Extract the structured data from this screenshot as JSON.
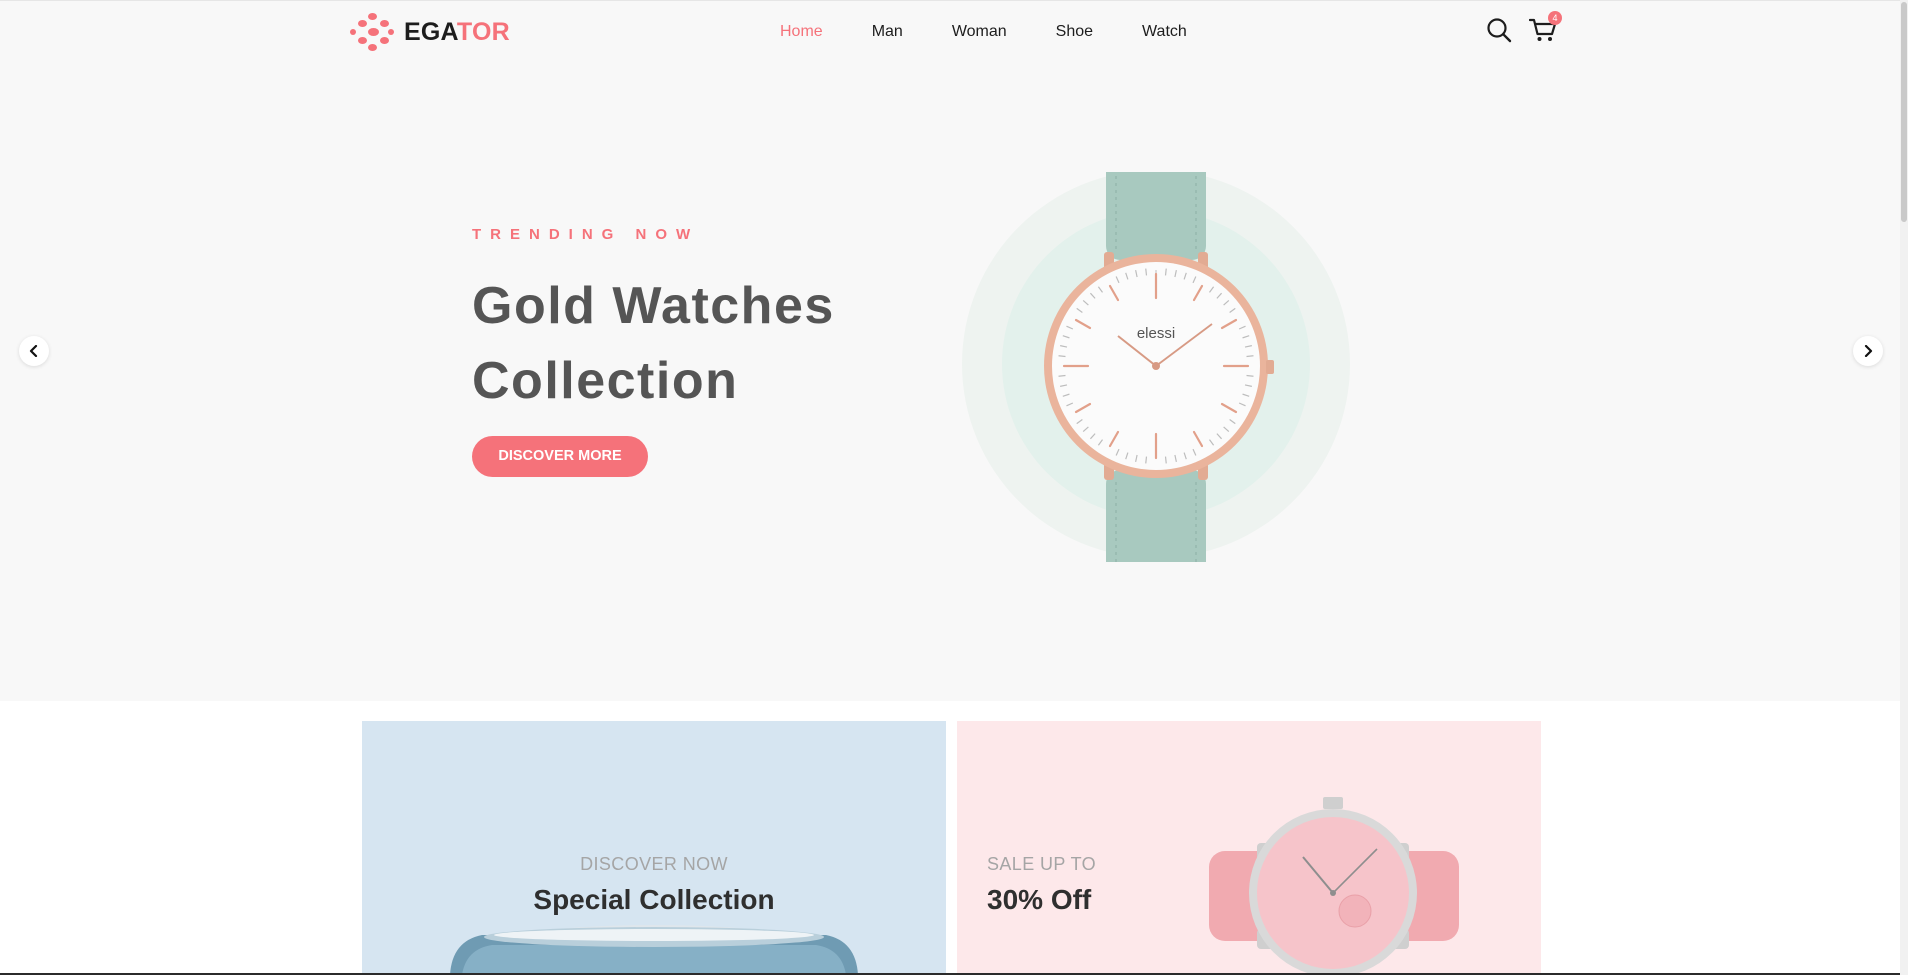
{
  "header": {
    "logo": {
      "part1": "EGA",
      "part2": "TOR"
    },
    "nav": [
      {
        "label": "Home",
        "active": true
      },
      {
        "label": "Man",
        "active": false
      },
      {
        "label": "Woman",
        "active": false
      },
      {
        "label": "Shoe",
        "active": false
      },
      {
        "label": "Watch",
        "active": false
      }
    ],
    "cart_count": "4"
  },
  "hero": {
    "eyebrow": "TRENDING NOW",
    "title": "Gold Watches Collection",
    "button": "DISCOVER MORE",
    "watch_brand": "elessi"
  },
  "banners": {
    "left": {
      "subtitle": "DISCOVER NOW",
      "title": "Special Collection"
    },
    "right": {
      "subtitle": "SALE UP TO",
      "title": "30% Off"
    }
  },
  "colors": {
    "accent": "#f5727a",
    "hero_bg": "#f8f8f8",
    "banner_blue": "#d6e5f1",
    "banner_pink": "#fde8ea"
  }
}
